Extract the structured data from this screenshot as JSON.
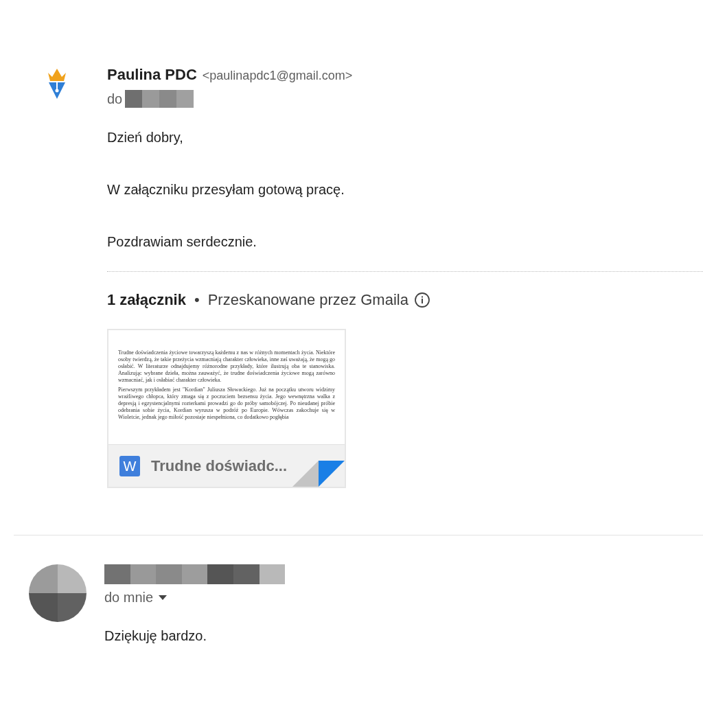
{
  "message": {
    "sender_name": "Paulina PDC",
    "sender_email": "<paulinapdc1@gmail.com>",
    "recipient_label": "do",
    "body": [
      "Dzień dobry,",
      "W załączniku przesyłam gotową pracę.",
      "Pozdrawiam serdecznie."
    ],
    "attachments_summary": {
      "count": "1 załącznik",
      "separator": "•",
      "scan_note": "Przeskanowane przez Gmaila"
    },
    "attachments": [
      {
        "file_icon": "W",
        "name": "Trudne doświadc...",
        "preview_paragraphs": [
          "Trudne doświadczenia życiowe towarzyszą każdemu z nas w różnych momentach życia. Niektóre osoby twierdzą, że takie przeżycia wzmacniają charakter człowieka, inne zaś uważają, że mogą go osłabić. W literaturze odnajdujemy różnorodne przykłady, które ilustrują oba te stanowiska. Analizując wybrane dzieła, można zauważyć, że trudne doświadczenia życiowe mogą zarówno wzmacniać, jak i osłabiać charakter człowieka.",
          "Pierwszym przykładem jest \"Kordian\" Juliusza Słowackiego. Już na początku utworu widzimy wrażliwego chłopca, który zmaga się z poczuciem bezsensu życia. Jego wewnętrzna walka z depresją i egzystencjalnymi rozterkami prowadzi go do próby samobójczej. Po nieudanej próbie odebrania sobie życia, Kordian wyrusza w podróż po Europie. Wówczas zakochuje się w Wioletcie, jednak jego miłość pozostaje niespełniona, co dodatkowo pogłębia"
        ]
      }
    ]
  },
  "reply": {
    "recipient_label": "do mnie",
    "body": [
      "Dziękuję bardzo."
    ]
  }
}
